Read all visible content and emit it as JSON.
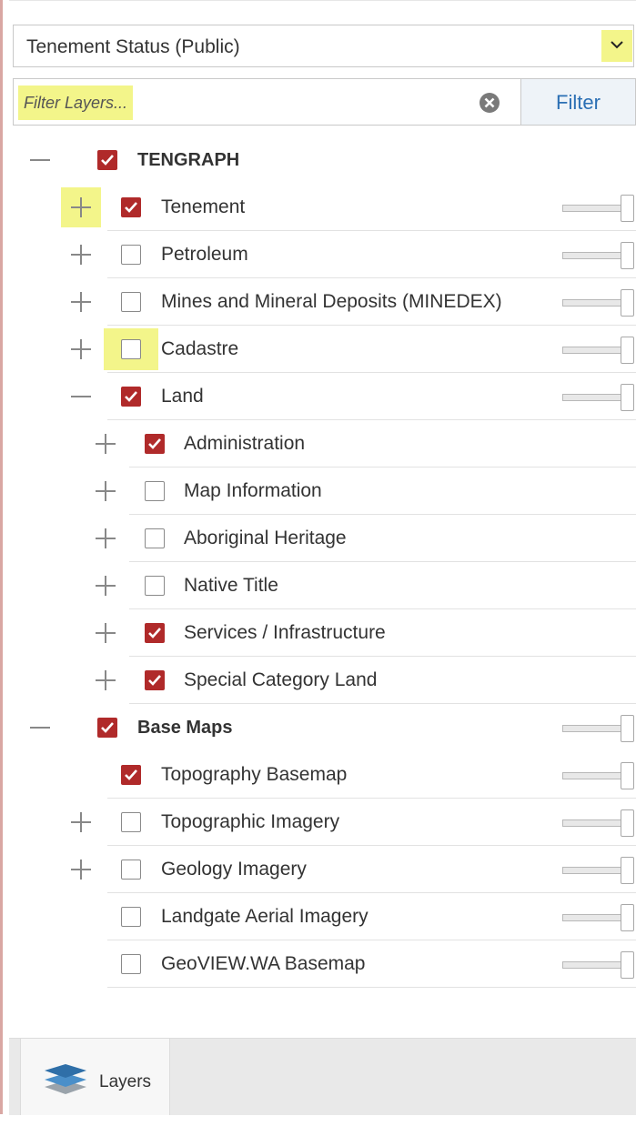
{
  "dropdown": {
    "value": "Tenement Status (Public)"
  },
  "filter": {
    "placeholder": "Filter Layers...",
    "button_label": "Filter"
  },
  "tree": [
    {
      "label": "TENGRAPH",
      "bold": true,
      "toggle": "minus",
      "checked": true,
      "slider": false
    },
    {
      "label": "Tenement",
      "toggle": "plus",
      "checked": true,
      "slider": true
    },
    {
      "label": "Petroleum",
      "toggle": "plus",
      "checked": false,
      "slider": true
    },
    {
      "label": "Mines and Mineral Deposits (MINEDEX)",
      "toggle": "plus",
      "checked": false,
      "slider": true
    },
    {
      "label": "Cadastre",
      "toggle": "plus",
      "checked": false,
      "slider": true
    },
    {
      "label": "Land",
      "toggle": "minus",
      "checked": true,
      "slider": true
    },
    {
      "label": "Administration",
      "toggle": "plus",
      "checked": true,
      "slider": false
    },
    {
      "label": "Map Information",
      "toggle": "plus",
      "checked": false,
      "slider": false
    },
    {
      "label": "Aboriginal Heritage",
      "toggle": "plus",
      "checked": false,
      "slider": false
    },
    {
      "label": "Native Title",
      "toggle": "plus",
      "checked": false,
      "slider": false
    },
    {
      "label": "Services / Infrastructure",
      "toggle": "plus",
      "checked": true,
      "slider": false
    },
    {
      "label": "Special Category Land",
      "toggle": "plus",
      "checked": true,
      "slider": false
    },
    {
      "label": "Base Maps",
      "bold": true,
      "toggle": "minus",
      "checked": true,
      "slider": true
    },
    {
      "label": "Topography Basemap",
      "toggle": "none",
      "checked": true,
      "slider": true
    },
    {
      "label": "Topographic Imagery",
      "toggle": "plus",
      "checked": false,
      "slider": true
    },
    {
      "label": "Geology Imagery",
      "toggle": "plus",
      "checked": false,
      "slider": true
    },
    {
      "label": "Landgate Aerial Imagery",
      "toggle": "none",
      "checked": false,
      "slider": true
    },
    {
      "label": "GeoVIEW.WA Basemap",
      "toggle": "none",
      "checked": false,
      "slider": true
    }
  ],
  "tabs": {
    "layers_label": "Layers"
  },
  "colors": {
    "checkbox_checked": "#b02a2a",
    "highlight": "#f3f58a",
    "filter_text": "#2b6fb4"
  },
  "icons": {
    "dropdown": "chevron-down-icon",
    "clear": "clear-x-icon",
    "expand": "plus-icon",
    "collapse": "minus-icon",
    "tab": "layers-icon"
  }
}
